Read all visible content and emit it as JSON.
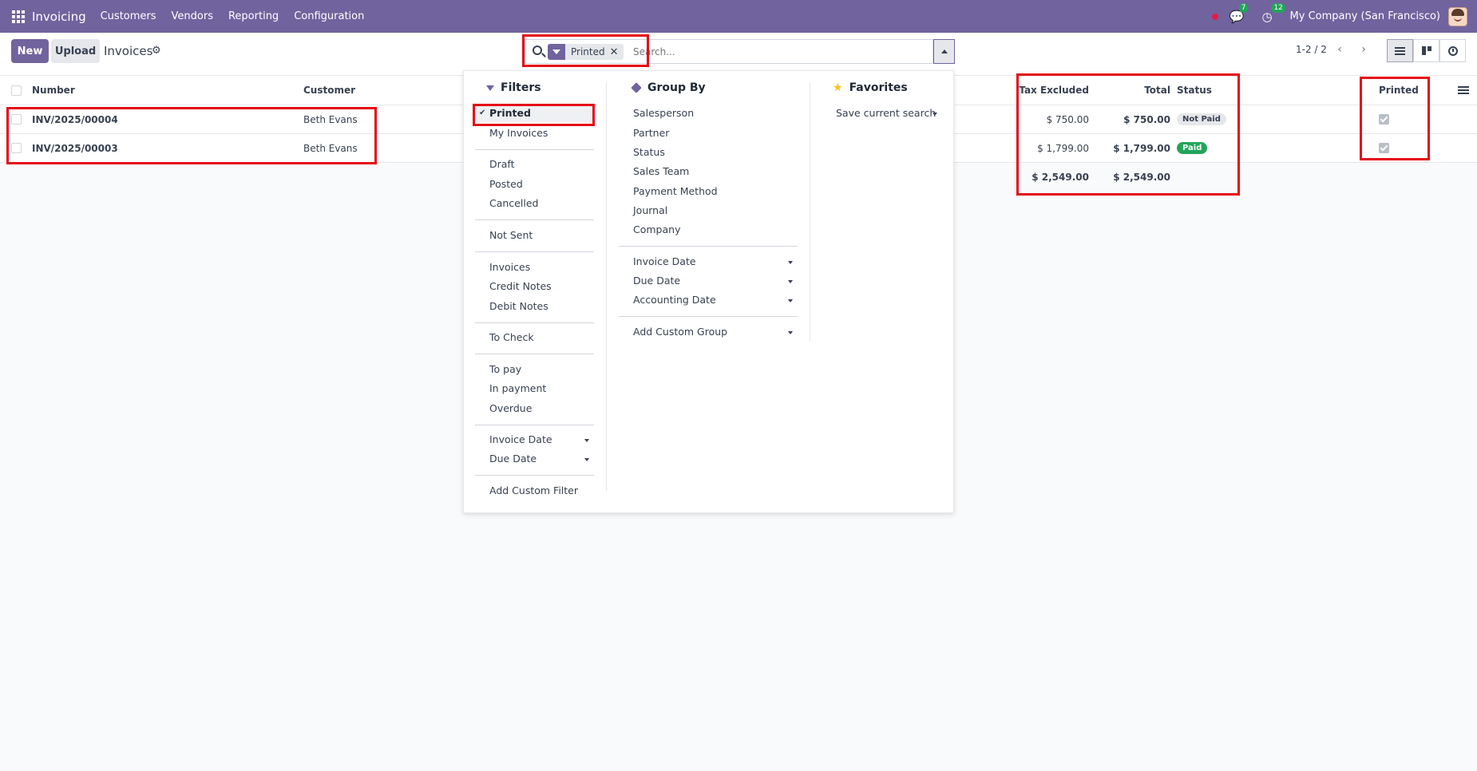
{
  "navbar": {
    "brand": "Invoicing",
    "menu": [
      "Customers",
      "Vendors",
      "Reporting",
      "Configuration"
    ],
    "messages_count": "7",
    "activities_count": "12",
    "company": "My Company (San Francisco)"
  },
  "control": {
    "new_label": "New",
    "upload_label": "Upload",
    "title": "Invoices",
    "facet_label": "Printed",
    "search_placeholder": "Search...",
    "pager": "1-2 / 2"
  },
  "list": {
    "headers": {
      "number": "Number",
      "customer": "Customer",
      "tax_excluded": "Tax Excluded",
      "total": "Total",
      "status": "Status",
      "printed": "Printed"
    },
    "rows": [
      {
        "number": "INV/2025/00004",
        "customer": "Beth Evans",
        "tax_excluded": "$ 750.00",
        "total": "$ 750.00",
        "status": "Not Paid",
        "printed": true
      },
      {
        "number": "INV/2025/00003",
        "customer": "Beth Evans",
        "tax_excluded": "$ 1,799.00",
        "total": "$ 1,799.00",
        "status": "Paid",
        "printed": true
      }
    ],
    "totals": {
      "tax_excluded": "$ 2,549.00",
      "total": "$ 2,549.00"
    }
  },
  "dropdown": {
    "filters": {
      "title": "Filters",
      "items": [
        "Printed",
        "My Invoices",
        "Draft",
        "Posted",
        "Cancelled",
        "Not Sent",
        "Invoices",
        "Credit Notes",
        "Debit Notes",
        "To Check",
        "To pay",
        "In payment",
        "Overdue",
        "Invoice Date",
        "Due Date",
        "Add Custom Filter"
      ]
    },
    "groupby": {
      "title": "Group By",
      "items": [
        "Salesperson",
        "Partner",
        "Status",
        "Sales Team",
        "Payment Method",
        "Journal",
        "Company",
        "Invoice Date",
        "Due Date",
        "Accounting Date",
        "Add Custom Group"
      ]
    },
    "favorites": {
      "title": "Favorites",
      "save": "Save current search"
    }
  },
  "colors": {
    "brand": "#71639e",
    "paid": "#22a55b",
    "annotation": "#e50914"
  }
}
